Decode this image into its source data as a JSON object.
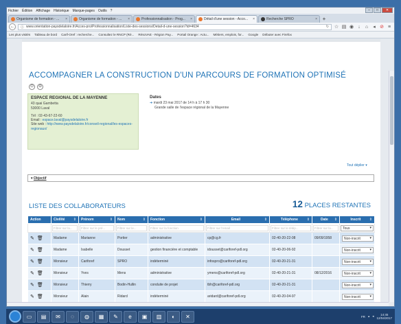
{
  "menu": [
    "Fichier",
    "Édition",
    "Affichage",
    "Historique",
    "Marque-pages",
    "Outils",
    "?"
  ],
  "tabs": [
    {
      "title": "Organisme de formation - ...",
      "active": false
    },
    {
      "title": "Organisme de formation - ...",
      "active": false
    },
    {
      "title": "Professionnalisation - Prog...",
      "active": false
    },
    {
      "title": "Détail d'une session - Acco...",
      "active": true
    },
    {
      "title": "Recherche SPRO",
      "active": false
    }
  ],
  "url": "www.orientation-paysdelaloire.fr/Acces-pro/Professionnalisation/Liste-des-sessions/Detail-d-une-session?id=4634",
  "bookmarks": [
    "Les plus visités",
    "Tableau de bord",
    "Carif-Oref : recherche...",
    "Consultez le RNCP (Ré...",
    "RésoVAE - Région Pay...",
    "Portail Orange : Actu...",
    "Métiers, emplois, for...",
    "Google",
    "Débuter avec Firefox"
  ],
  "page": {
    "title": "ACCOMPAGNER LA CONSTRUCTION D'UN PARCOURS DE FORMATION OPTIMISÉ",
    "org": {
      "name": "ESPACE REGIONAL DE LA MAYENNE",
      "address1": "43 quai Gambetta",
      "address2": "53000 Laval",
      "tel": "Tél : 02-43-67-22-60",
      "email_label": "Email :",
      "email": "espace.laval@paysdelaloire.fr",
      "site_label": "Site web :",
      "site": "http://www.paysdelaloire.fr/conseil-regional/les-espaces-regionaux/"
    },
    "dates": {
      "heading": "Dates",
      "date": "mardi 23 mai 2017 de 14 h à 17 h 30",
      "location": "Grande salle de l'espace régional de la Mayenne"
    },
    "deploy": "Tout déplier",
    "objectif": "Objectif",
    "liste_title": "LISTE DES COLLABORATEURS",
    "places_count": "12",
    "places_label": "PLACES RESTANTES"
  },
  "table": {
    "headers": [
      "Action",
      "Civilité",
      "Prénom",
      "Nom",
      "Fonction",
      "Email",
      "Téléphone",
      "Date",
      "Inscrit"
    ],
    "filters": [
      "Filtrer sur la...",
      "Filtrer sur le pré...",
      "Filtrer sur le...",
      "Filtrer sur la fonction",
      "Filtrer sur l'email",
      "Filtrer sur le télép...",
      "Filtrer sur la...",
      "Tous"
    ],
    "rows": [
      {
        "civ": "Madame",
        "prenom": "Marianne",
        "nom": "Portier",
        "fonction": "administrative",
        "email": "cp@cg.fr",
        "tel": "02-40-20-22-08",
        "date": "09/09/1958",
        "inscrit": "Non-inscrit"
      },
      {
        "civ": "Madame",
        "prenom": "Isabelle",
        "nom": "Dousset",
        "fonction": "gestion financière et comptable",
        "email": "idousset@cariforef-pdl.org",
        "tel": "02-40-20-06-92",
        "date": "",
        "inscrit": "Non-inscrit"
      },
      {
        "civ": "Monsieur",
        "prenom": "Cariforef",
        "nom": "SPRO",
        "fonction": "indéterminé",
        "email": "infospro@cariforef-pdl.org",
        "tel": "02-40-20-21-31",
        "date": "",
        "inscrit": "Non-inscrit"
      },
      {
        "civ": "Monsieur",
        "prenom": "Yves",
        "nom": "Mens",
        "fonction": "administrative",
        "email": "ymens@cariforef-pdl.org",
        "tel": "02-40-20-21-31",
        "date": "08/12/2016",
        "inscrit": "Non-inscrit"
      },
      {
        "civ": "Monsieur",
        "prenom": "Thierry",
        "nom": "Bodin-Hullin",
        "fonction": "conduite de projet",
        "email": "tbh@cariforef-pdl.org",
        "tel": "02-40-20-21-31",
        "date": "",
        "inscrit": "Non-inscrit"
      },
      {
        "civ": "Monsieur",
        "prenom": "Alain",
        "nom": "Ridard",
        "fonction": "indéterminé",
        "email": "aridard@cariforef-pdl.org",
        "tel": "02-40-20-04-97",
        "date": "",
        "inscrit": "Non-inscrit"
      }
    ]
  },
  "tray": {
    "lang": "FR",
    "time": "14:45",
    "date": "12/04/2017"
  }
}
